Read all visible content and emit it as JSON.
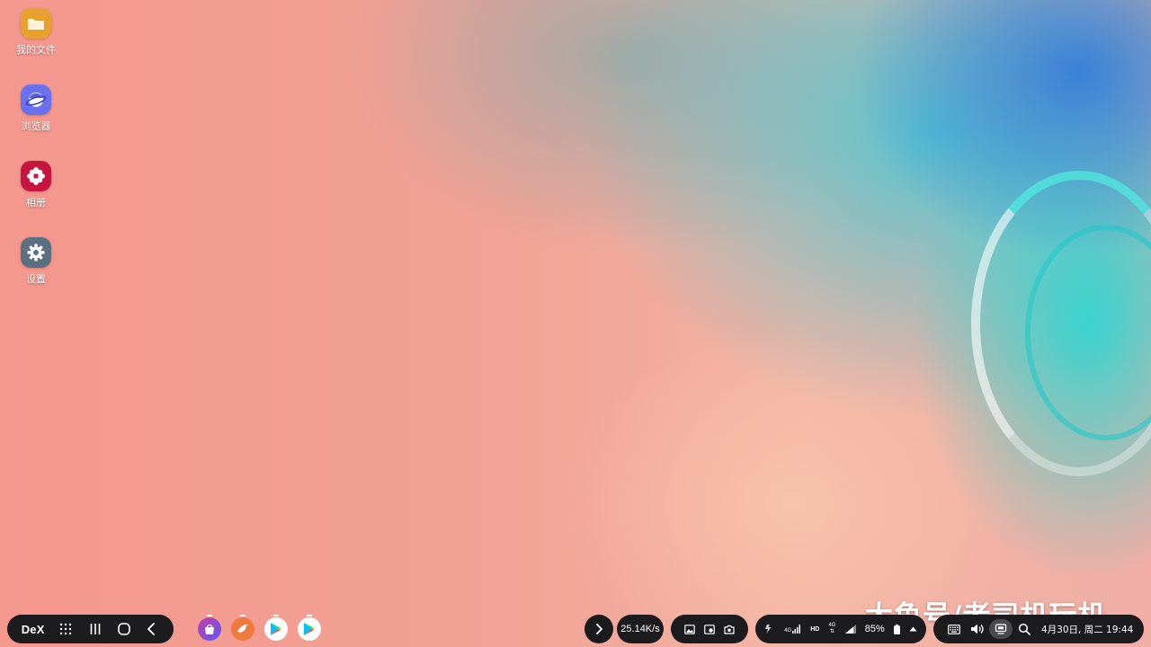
{
  "desktop": {
    "icons": [
      {
        "label": "我的文件",
        "icon": "folder-icon",
        "color": "#e8a12c"
      },
      {
        "label": "浏览器",
        "icon": "browser-icon",
        "color": "#6a71f0"
      },
      {
        "label": "相册",
        "icon": "gallery-icon",
        "color": "#c8153f"
      },
      {
        "label": "设置",
        "icon": "gear-icon",
        "color": "#5b6f82"
      }
    ]
  },
  "taskbar": {
    "dex_label": "DeX",
    "nav_icons": [
      "apps-grid-icon",
      "recents-icon",
      "home-icon",
      "back-icon"
    ],
    "pinned_apps": [
      "galaxy-store-icon",
      "bird-app-icon",
      "play-store-icon",
      "play-store-icon"
    ],
    "expand_icon": "chevron-right-icon",
    "network_speed": "25.14K/s",
    "notification_icons": [
      "image-icon",
      "screen-record-icon",
      "camera-icon"
    ],
    "status": {
      "signal_label_a": "4G",
      "hd_label": "HD",
      "signal_label_b": "4G",
      "battery_percent": "85%"
    },
    "tray_icons": [
      "keyboard-icon",
      "volume-icon",
      "screen-cast-icon",
      "search-icon"
    ],
    "datetime": "4月30日, 周二 19:44"
  },
  "watermark": "大鱼号/老司机玩机"
}
